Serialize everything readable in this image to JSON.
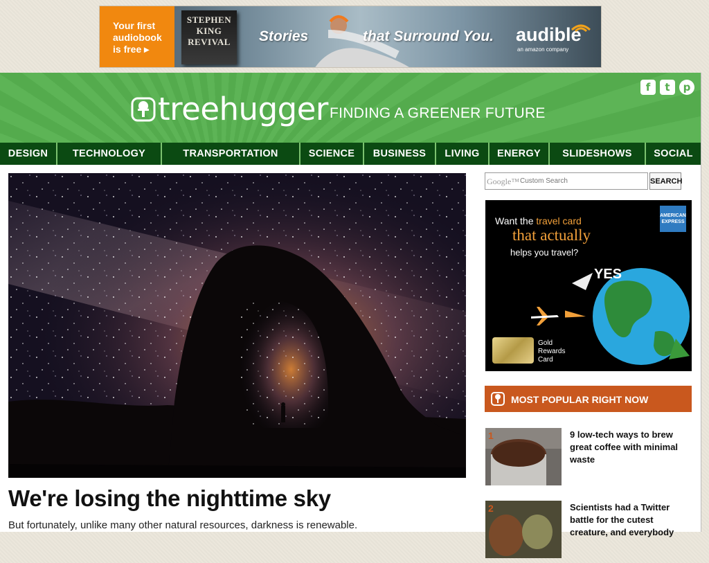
{
  "banner_ad": {
    "promo": "Your first\naudiobook\nis free ▸",
    "book_title": "STEPHEN\nKING\nREVIVAL",
    "slogan_part1": "Stories",
    "slogan_part2": "that Surround You.",
    "brand": "audible",
    "brand_sub": "an amazon company"
  },
  "header": {
    "logo": "treehugger",
    "tagline": "FINDING A GREENER FUTURE",
    "social": [
      {
        "name": "facebook",
        "glyph": "f"
      },
      {
        "name": "twitter",
        "glyph": "t"
      },
      {
        "name": "pinterest",
        "glyph": "p"
      }
    ]
  },
  "nav": {
    "items": [
      "DESIGN",
      "TECHNOLOGY",
      "TRANSPORTATION",
      "SCIENCE",
      "BUSINESS",
      "LIVING",
      "ENERGY",
      "SLIDESHOWS",
      "SOCIAL"
    ]
  },
  "article": {
    "headline": "We're losing the nighttime sky",
    "dek": "But fortunately, unlike many other natural resources, darkness is renewable."
  },
  "search": {
    "google_mark": "Google™",
    "placeholder": "Custom Search",
    "button": "SEARCH"
  },
  "side_ad": {
    "line1_a": "Want the ",
    "line1_b": "travel card",
    "line2": "that actually",
    "line3": "helps you travel?",
    "yes": "YES",
    "card_text": "Gold\nRewards\nCard",
    "amex": "AMERICAN\nEXPRESS"
  },
  "popular": {
    "title": "MOST POPULAR RIGHT NOW",
    "items": [
      {
        "num": "1",
        "text": "9 low-tech ways to brew great coffee with minimal waste"
      },
      {
        "num": "2",
        "text": "Scientists had a Twitter battle for the cutest creature, and everybody"
      }
    ]
  },
  "colors": {
    "header_green": "#5db456",
    "nav_dark_green": "#0b4a12",
    "popular_orange": "#c9581e"
  }
}
